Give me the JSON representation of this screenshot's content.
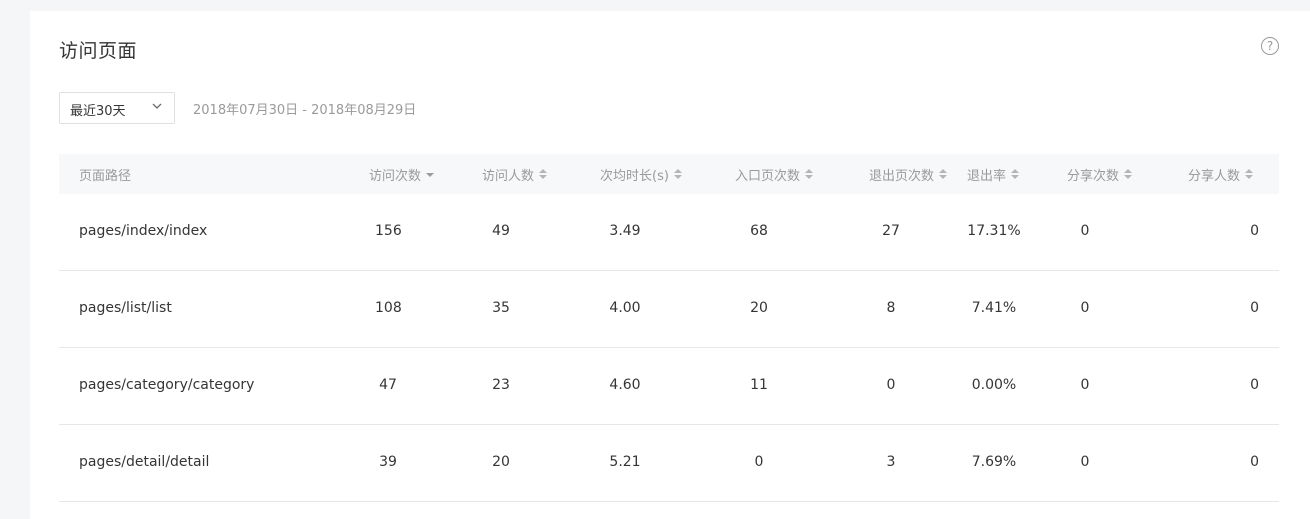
{
  "page": {
    "title": "访问页面",
    "help_icon": "question-circle-icon"
  },
  "filter": {
    "range_label": "最近30天",
    "date_range": "2018年07月30日 - 2018年08月29日"
  },
  "table": {
    "columns": [
      {
        "label": "页面路径",
        "sortable": false
      },
      {
        "label": "访问次数",
        "sortable": true,
        "sorted": "desc"
      },
      {
        "label": "访问人数",
        "sortable": true
      },
      {
        "label": "次均时长(s)",
        "sortable": true
      },
      {
        "label": "入口页次数",
        "sortable": true
      },
      {
        "label": "退出页次数",
        "sortable": true
      },
      {
        "label": "退出率",
        "sortable": true
      },
      {
        "label": "分享次数",
        "sortable": true
      },
      {
        "label": "分享人数",
        "sortable": true
      }
    ],
    "rows": [
      [
        "pages/index/index",
        "156",
        "49",
        "3.49",
        "68",
        "27",
        "17.31%",
        "0",
        "0"
      ],
      [
        "pages/list/list",
        "108",
        "35",
        "4.00",
        "20",
        "8",
        "7.41%",
        "0",
        "0"
      ],
      [
        "pages/category/category",
        "47",
        "23",
        "4.60",
        "11",
        "0",
        "0.00%",
        "0",
        "0"
      ],
      [
        "pages/detail/detail",
        "39",
        "20",
        "5.21",
        "0",
        "3",
        "7.69%",
        "0",
        "0"
      ]
    ]
  }
}
